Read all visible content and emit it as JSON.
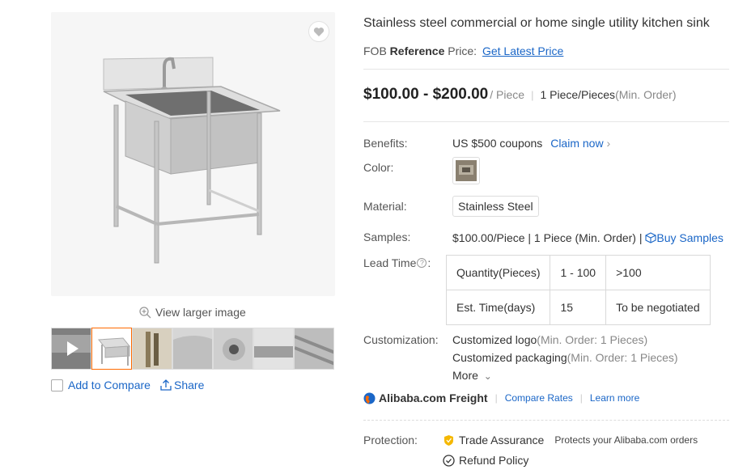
{
  "product": {
    "title": "Stainless steel commercial or home single utility kitchen sink",
    "fob_prefix": "FOB",
    "fob_bold": "Reference",
    "fob_suffix": "Price:",
    "latest_price_link": "Get Latest Price",
    "price_range": "$100.00 - $200.00",
    "price_unit": "/ Piece",
    "moq": "1 Piece/Pieces",
    "moq_note": "(Min. Order)"
  },
  "gallery": {
    "view_larger": "View larger image",
    "thumbnail_count": 7,
    "selected_thumbnail": 2,
    "add_to_compare": "Add to Compare",
    "share": "Share"
  },
  "attributes": {
    "benefits_label": "Benefits:",
    "benefits_value": "US $500 coupons",
    "claim_now": "Claim now",
    "color_label": "Color:",
    "material_label": "Material:",
    "material_value": "Stainless Steel",
    "samples_label": "Samples:",
    "samples_value": "$100.00/Piece | 1 Piece (Min. Order) |",
    "buy_samples": "Buy Samples",
    "lead_time_label": "Lead Time",
    "lead_time_table": {
      "rows": [
        [
          "Quantity(Pieces)",
          "1 - 100",
          ">100"
        ],
        [
          "Est. Time(days)",
          "15",
          "To be negotiated"
        ]
      ]
    },
    "customization_label": "Customization:",
    "customized_logo": "Customized logo",
    "customized_logo_note": "(Min. Order: 1 Pieces)",
    "customized_packaging": "Customized packaging",
    "customized_packaging_note": "(Min. Order: 1 Pieces)",
    "more": "More"
  },
  "freight": {
    "brand": "Alibaba.com Freight",
    "compare_rates": "Compare Rates",
    "learn_more": "Learn more"
  },
  "protection": {
    "label": "Protection:",
    "trade_assurance": "Trade Assurance",
    "trade_assurance_note": "Protects your Alibaba.com orders",
    "refund_policy": "Refund Policy"
  },
  "colors": {
    "link": "#1a66c7",
    "selected_thumb_border": "#ff6a00",
    "trade_assurance_badge": "#f5b800"
  }
}
